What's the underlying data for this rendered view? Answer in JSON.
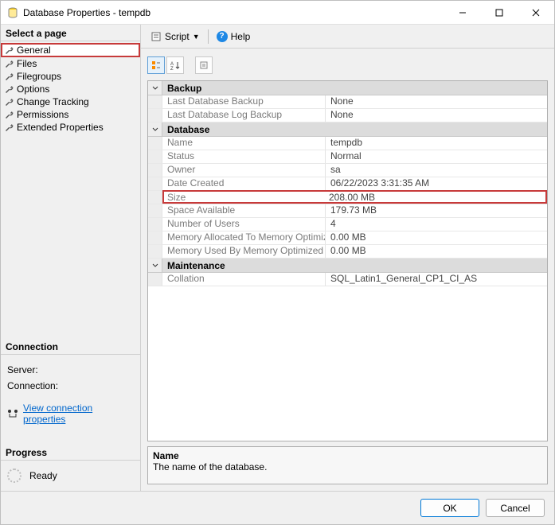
{
  "window": {
    "title": "Database Properties - tempdb",
    "min": "—",
    "max": "☐",
    "close": "✕"
  },
  "left": {
    "selectHeader": "Select a page",
    "pages": [
      "General",
      "Files",
      "Filegroups",
      "Options",
      "Change Tracking",
      "Permissions",
      "Extended Properties"
    ],
    "connectionHeader": "Connection",
    "serverLabel": "Server:",
    "connectionLabel": "Connection:",
    "viewConn": "View connection properties",
    "progressHeader": "Progress",
    "readyLabel": "Ready"
  },
  "toolbar": {
    "script": "Script",
    "help": "Help"
  },
  "grid": {
    "categories": [
      {
        "name": "Backup",
        "rows": [
          {
            "label": "Last Database Backup",
            "value": "None"
          },
          {
            "label": "Last Database Log Backup",
            "value": "None"
          }
        ]
      },
      {
        "name": "Database",
        "rows": [
          {
            "label": "Name",
            "value": "tempdb"
          },
          {
            "label": "Status",
            "value": "Normal"
          },
          {
            "label": "Owner",
            "value": "sa"
          },
          {
            "label": "Date Created",
            "value": "06/22/2023 3:31:35 AM"
          },
          {
            "label": "Size",
            "value": "208.00 MB",
            "highlight": true
          },
          {
            "label": "Space Available",
            "value": "179.73 MB"
          },
          {
            "label": "Number of Users",
            "value": "4"
          },
          {
            "label": "Memory Allocated To Memory Optimized Obje",
            "value": "0.00 MB"
          },
          {
            "label": "Memory Used By Memory Optimized Objects",
            "value": "0.00 MB"
          }
        ]
      },
      {
        "name": "Maintenance",
        "rows": [
          {
            "label": "Collation",
            "value": "SQL_Latin1_General_CP1_CI_AS"
          }
        ]
      }
    ]
  },
  "desc": {
    "name": "Name",
    "text": "The name of the database."
  },
  "buttons": {
    "ok": "OK",
    "cancel": "Cancel"
  }
}
